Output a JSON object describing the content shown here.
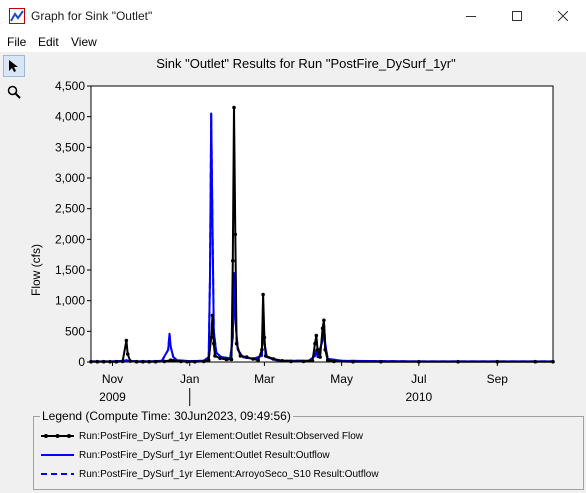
{
  "window": {
    "title": "Graph for Sink \"Outlet\"",
    "controls": {
      "minimize": "minimize",
      "maximize": "maximize",
      "close": "close"
    }
  },
  "menu": {
    "items": [
      "File",
      "Edit",
      "View"
    ]
  },
  "tools": [
    {
      "name": "pointer-tool",
      "icon": "arrow-pointer-icon"
    },
    {
      "name": "zoom-tool",
      "icon": "magnifier-icon"
    }
  ],
  "chart_data": {
    "type": "line",
    "title": "Sink \"Outlet\" Results for Run \"PostFire_DySurf_1yr\"",
    "ylabel": "Flow (cfs)",
    "xlabel": "",
    "ylim": [
      0,
      4500
    ],
    "yticks": [
      "0",
      "500",
      "1,000",
      "1,500",
      "2,000",
      "2,500",
      "3,000",
      "3,500",
      "4,000",
      "4,500"
    ],
    "xlim": [
      "2009-10-15",
      "2010-10-15"
    ],
    "xticks": [
      {
        "label": "Nov",
        "date": "2009-11-01"
      },
      {
        "label": "Jan",
        "date": "2010-01-01"
      },
      {
        "label": "Mar",
        "date": "2010-03-01"
      },
      {
        "label": "May",
        "date": "2010-05-01"
      },
      {
        "label": "Jul",
        "date": "2010-07-01"
      },
      {
        "label": "Sep",
        "date": "2010-09-01"
      }
    ],
    "years": [
      {
        "label": "2009",
        "date": "2009-11-01"
      },
      {
        "label": "2010",
        "date": "2010-07-01"
      }
    ],
    "year_divider": "2010-01-01",
    "grid": false,
    "series": [
      {
        "name": "Run:PostFire_DySurf_1yr Element:Outlet Result:Observed Flow",
        "color": "#000000",
        "style": "solid",
        "markers": true,
        "points": [
          [
            "2009-10-15",
            5
          ],
          [
            "2009-10-20",
            5
          ],
          [
            "2009-10-25",
            5
          ],
          [
            "2009-10-30",
            5
          ],
          [
            "2009-11-04",
            5
          ],
          [
            "2009-11-09",
            10
          ],
          [
            "2009-11-12",
            350
          ],
          [
            "2009-11-13",
            130
          ],
          [
            "2009-11-15",
            15
          ],
          [
            "2009-11-20",
            5
          ],
          [
            "2009-11-25",
            5
          ],
          [
            "2009-11-30",
            5
          ],
          [
            "2009-12-05",
            5
          ],
          [
            "2009-12-12",
            10
          ],
          [
            "2009-12-17",
            30
          ],
          [
            "2009-12-19",
            20
          ],
          [
            "2009-12-25",
            10
          ],
          [
            "2009-12-30",
            5
          ],
          [
            "2010-01-05",
            5
          ],
          [
            "2010-01-12",
            10
          ],
          [
            "2010-01-16",
            30
          ],
          [
            "2010-01-18",
            400
          ],
          [
            "2010-01-19",
            760
          ],
          [
            "2010-01-20",
            300
          ],
          [
            "2010-01-21",
            100
          ],
          [
            "2010-01-25",
            60
          ],
          [
            "2010-01-30",
            40
          ],
          [
            "2010-02-03",
            40
          ],
          [
            "2010-02-04",
            1650
          ],
          [
            "2010-02-05",
            4150
          ],
          [
            "2010-02-06",
            2080
          ],
          [
            "2010-02-07",
            300
          ],
          [
            "2010-02-10",
            100
          ],
          [
            "2010-02-15",
            80
          ],
          [
            "2010-02-20",
            50
          ],
          [
            "2010-02-24",
            30
          ],
          [
            "2010-02-27",
            200
          ],
          [
            "2010-02-28",
            1100
          ],
          [
            "2010-03-01",
            400
          ],
          [
            "2010-03-02",
            100
          ],
          [
            "2010-03-08",
            50
          ],
          [
            "2010-03-15",
            20
          ],
          [
            "2010-03-22",
            10
          ],
          [
            "2010-04-01",
            10
          ],
          [
            "2010-04-08",
            20
          ],
          [
            "2010-04-10",
            300
          ],
          [
            "2010-04-11",
            430
          ],
          [
            "2010-04-12",
            200
          ],
          [
            "2010-04-14",
            80
          ],
          [
            "2010-04-16",
            550
          ],
          [
            "2010-04-17",
            680
          ],
          [
            "2010-04-18",
            200
          ],
          [
            "2010-04-20",
            30
          ],
          [
            "2010-04-25",
            10
          ],
          [
            "2010-05-10",
            5
          ],
          [
            "2010-06-01",
            5
          ],
          [
            "2010-07-01",
            5
          ],
          [
            "2010-08-01",
            5
          ],
          [
            "2010-09-01",
            5
          ],
          [
            "2010-10-01",
            5
          ],
          [
            "2010-10-15",
            5
          ]
        ]
      },
      {
        "name": "Run:PostFire_DySurf_1yr Element:Outlet Result:Outflow",
        "color": "#0000ff",
        "style": "solid",
        "markers": false,
        "points": [
          [
            "2009-10-15",
            10
          ],
          [
            "2009-11-01",
            10
          ],
          [
            "2009-11-10",
            20
          ],
          [
            "2009-11-12",
            30
          ],
          [
            "2009-11-14",
            15
          ],
          [
            "2009-12-01",
            10
          ],
          [
            "2009-12-10",
            20
          ],
          [
            "2009-12-15",
            200
          ],
          [
            "2009-12-16",
            460
          ],
          [
            "2009-12-17",
            250
          ],
          [
            "2009-12-19",
            80
          ],
          [
            "2009-12-22",
            30
          ],
          [
            "2010-01-01",
            15
          ],
          [
            "2010-01-12",
            20
          ],
          [
            "2010-01-16",
            80
          ],
          [
            "2010-01-17",
            1400
          ],
          [
            "2010-01-18",
            4050
          ],
          [
            "2010-01-19",
            2200
          ],
          [
            "2010-01-20",
            500
          ],
          [
            "2010-01-22",
            150
          ],
          [
            "2010-01-26",
            80
          ],
          [
            "2010-02-02",
            60
          ],
          [
            "2010-02-04",
            400
          ],
          [
            "2010-02-05",
            1450
          ],
          [
            "2010-02-06",
            700
          ],
          [
            "2010-02-08",
            200
          ],
          [
            "2010-02-12",
            80
          ],
          [
            "2010-02-20",
            50
          ],
          [
            "2010-02-27",
            100
          ],
          [
            "2010-02-28",
            820
          ],
          [
            "2010-03-01",
            300
          ],
          [
            "2010-03-03",
            80
          ],
          [
            "2010-03-10",
            30
          ],
          [
            "2010-03-20",
            20
          ],
          [
            "2010-04-05",
            20
          ],
          [
            "2010-04-10",
            100
          ],
          [
            "2010-04-11",
            200
          ],
          [
            "2010-04-12",
            80
          ],
          [
            "2010-04-16",
            350
          ],
          [
            "2010-04-17",
            650
          ],
          [
            "2010-04-18",
            300
          ],
          [
            "2010-04-20",
            50
          ],
          [
            "2010-05-01",
            20
          ],
          [
            "2010-06-01",
            15
          ],
          [
            "2010-07-01",
            10
          ],
          [
            "2010-08-01",
            10
          ],
          [
            "2010-09-01",
            10
          ],
          [
            "2010-10-15",
            10
          ]
        ]
      },
      {
        "name": "Run:PostFire_DySurf_1yr Element:ArroyoSeco_S10 Result:Outflow",
        "color": "#0000ff",
        "style": "dashed",
        "markers": false,
        "points": [
          [
            "2009-10-15",
            10
          ],
          [
            "2009-11-01",
            10
          ],
          [
            "2009-11-10",
            20
          ],
          [
            "2009-11-12",
            30
          ],
          [
            "2009-11-14",
            15
          ],
          [
            "2009-12-01",
            10
          ],
          [
            "2009-12-10",
            20
          ],
          [
            "2009-12-15",
            200
          ],
          [
            "2009-12-16",
            460
          ],
          [
            "2009-12-17",
            250
          ],
          [
            "2009-12-19",
            80
          ],
          [
            "2009-12-22",
            30
          ],
          [
            "2010-01-01",
            15
          ],
          [
            "2010-01-12",
            20
          ],
          [
            "2010-01-16",
            80
          ],
          [
            "2010-01-17",
            1400
          ],
          [
            "2010-01-18",
            4050
          ],
          [
            "2010-01-19",
            2200
          ],
          [
            "2010-01-20",
            500
          ],
          [
            "2010-01-22",
            150
          ],
          [
            "2010-01-26",
            80
          ],
          [
            "2010-02-02",
            60
          ],
          [
            "2010-02-04",
            400
          ],
          [
            "2010-02-05",
            1450
          ],
          [
            "2010-02-06",
            700
          ],
          [
            "2010-02-08",
            200
          ],
          [
            "2010-02-12",
            80
          ],
          [
            "2010-02-20",
            50
          ],
          [
            "2010-02-27",
            100
          ],
          [
            "2010-02-28",
            820
          ],
          [
            "2010-03-01",
            300
          ],
          [
            "2010-03-03",
            80
          ],
          [
            "2010-03-10",
            30
          ],
          [
            "2010-03-20",
            20
          ],
          [
            "2010-04-05",
            20
          ],
          [
            "2010-04-10",
            100
          ],
          [
            "2010-04-11",
            200
          ],
          [
            "2010-04-12",
            80
          ],
          [
            "2010-04-16",
            350
          ],
          [
            "2010-04-17",
            650
          ],
          [
            "2010-04-18",
            300
          ],
          [
            "2010-04-20",
            50
          ],
          [
            "2010-05-01",
            20
          ],
          [
            "2010-06-01",
            15
          ],
          [
            "2010-07-01",
            10
          ],
          [
            "2010-08-01",
            10
          ],
          [
            "2010-09-01",
            10
          ],
          [
            "2010-10-15",
            10
          ]
        ]
      }
    ]
  },
  "legend": {
    "title": "Legend (Compute Time: 30Jun2023, 09:49:56)",
    "items": [
      {
        "label": "Run:PostFire_DySurf_1yr Element:Outlet Result:Observed Flow",
        "color": "#000000",
        "style": "solid",
        "markers": true
      },
      {
        "label": "Run:PostFire_DySurf_1yr Element:Outlet Result:Outflow",
        "color": "#0000ff",
        "style": "solid",
        "markers": false
      },
      {
        "label": "Run:PostFire_DySurf_1yr Element:ArroyoSeco_S10 Result:Outflow",
        "color": "#0000ff",
        "style": "dashed",
        "markers": false
      }
    ]
  }
}
